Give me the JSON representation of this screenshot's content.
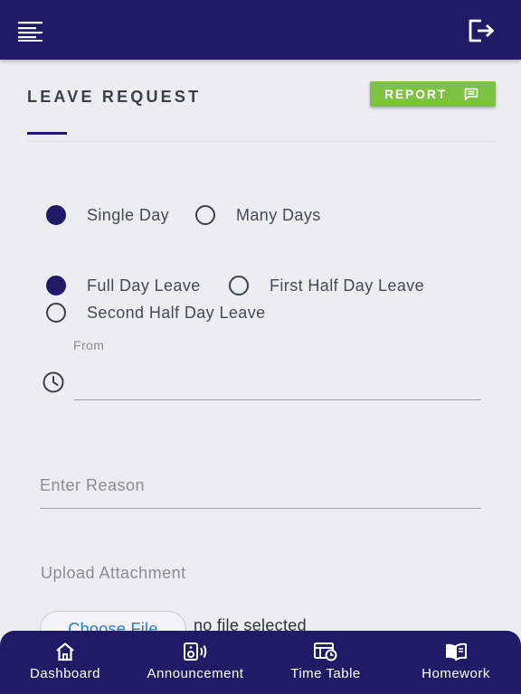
{
  "header": {
    "menu_icon": "menu-icon",
    "logout_icon": "logout-icon"
  },
  "page": {
    "title": "LEAVE REQUEST",
    "report_label": "REPORT",
    "report_icon": "message-icon"
  },
  "duration": {
    "options": [
      {
        "label": "Single Day",
        "checked": true
      },
      {
        "label": "Many Days",
        "checked": false
      }
    ]
  },
  "leave_type": {
    "options": [
      {
        "label": "Full Day Leave",
        "checked": true
      },
      {
        "label": "First Half Day Leave",
        "checked": false
      },
      {
        "label": "Second Half Day Leave",
        "checked": false
      }
    ]
  },
  "from": {
    "label": "From",
    "value": "",
    "icon": "clock-icon"
  },
  "reason": {
    "placeholder": "Enter Reason",
    "value": ""
  },
  "attachment": {
    "label": "Upload Attachment",
    "button_label": "Choose File",
    "status": "no file selected"
  },
  "bottom_nav": {
    "items": [
      {
        "label": "Dashboard",
        "icon": "home-icon"
      },
      {
        "label": "Announcement",
        "icon": "speaker-icon"
      },
      {
        "label": "Time Table",
        "icon": "timetable-icon"
      },
      {
        "label": "Homework",
        "icon": "book-icon"
      }
    ]
  },
  "colors": {
    "primary": "#221A66",
    "accent": "#7DC242",
    "background": "#ECECF1",
    "link": "#2A78C6"
  }
}
